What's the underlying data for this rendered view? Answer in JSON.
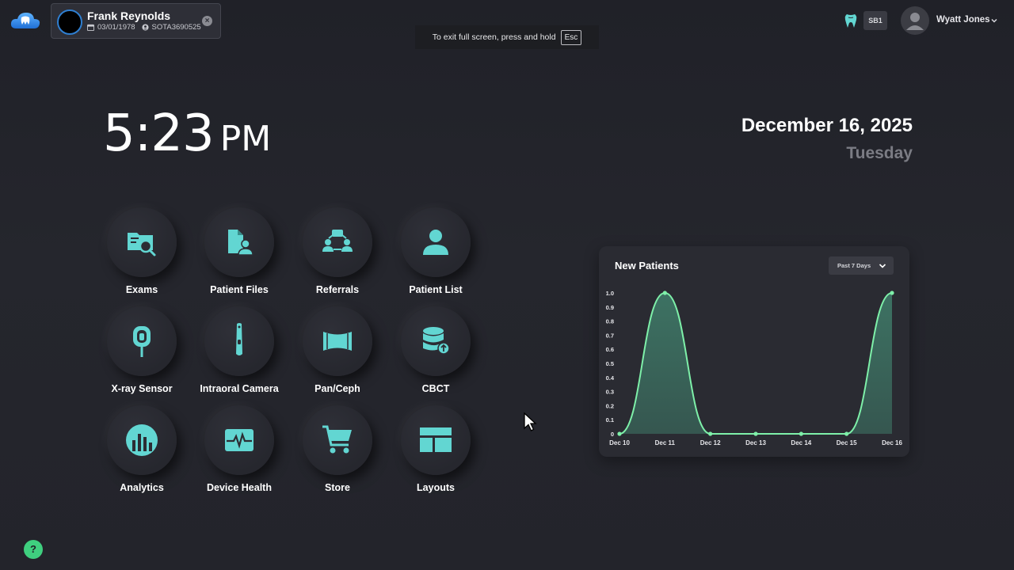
{
  "patient": {
    "name": "Frank Reynolds",
    "dob": "03/01/1978",
    "id": "SOTA3690525"
  },
  "toast": {
    "message": "To exit full screen, press and hold",
    "key": "Esc"
  },
  "header": {
    "site_badge": "SB1",
    "user_name": "Wyatt Jones"
  },
  "clock": {
    "time": "5:23",
    "ampm": "PM"
  },
  "date": {
    "full": "December 16, 2025",
    "weekday": "Tuesday"
  },
  "tiles": [
    {
      "label": "Exams",
      "icon": "folder-search-icon"
    },
    {
      "label": "Patient Files",
      "icon": "file-user-icon"
    },
    {
      "label": "Referrals",
      "icon": "referral-network-icon"
    },
    {
      "label": "Patient List",
      "icon": "person-icon"
    },
    {
      "label": "X-ray Sensor",
      "icon": "xray-sensor-icon"
    },
    {
      "label": "Intraoral Camera",
      "icon": "intraoral-camera-icon"
    },
    {
      "label": "Pan/Ceph",
      "icon": "panoramic-icon"
    },
    {
      "label": "CBCT",
      "icon": "database-upload-icon"
    },
    {
      "label": "Analytics",
      "icon": "bar-chart-icon"
    },
    {
      "label": "Device Health",
      "icon": "heartbeat-monitor-icon"
    },
    {
      "label": "Store",
      "icon": "shopping-cart-icon"
    },
    {
      "label": "Layouts",
      "icon": "layout-grid-icon"
    }
  ],
  "colors": {
    "accent": "#62d6d2",
    "chart_line": "#7ef0a9",
    "chart_fill": "#3f7a68"
  },
  "chart_data": {
    "type": "area",
    "title": "New Patients",
    "range_selector": "Past 7 Days",
    "categories": [
      "Dec 10",
      "Dec 11",
      "Dec 12",
      "Dec 13",
      "Dec 14",
      "Dec 15",
      "Dec 16"
    ],
    "values": [
      0,
      1,
      0,
      0,
      0,
      0,
      1
    ],
    "yticks": [
      "0",
      "0.1",
      "0.2",
      "0.3",
      "0.4",
      "0.5",
      "0.6",
      "0.7",
      "0.8",
      "0.9",
      "1.0"
    ],
    "ylim": [
      0,
      1.0
    ],
    "grid": false
  },
  "help": {
    "label": "?"
  }
}
